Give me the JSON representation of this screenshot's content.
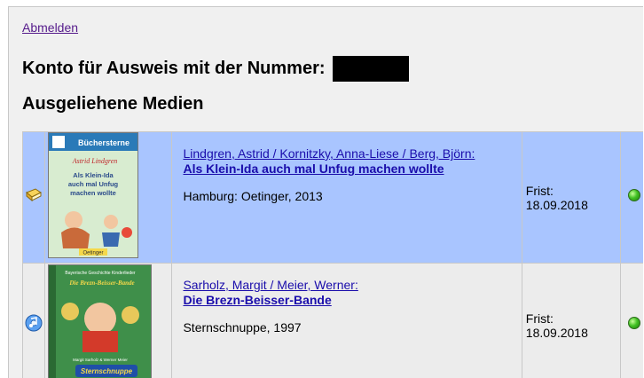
{
  "header": {
    "logout_label": "Abmelden",
    "account_heading": "Konto für Ausweis mit der Nummer:",
    "media_heading": "Ausgeliehene Medien"
  },
  "loans": [
    {
      "media_type_icon": "book-icon",
      "cover_title": "Als Klein-Ida auch mal Unfug machen wollte",
      "cover_series": "Büchersterne",
      "cover_author": "Astrid Lindgren",
      "cover_publisher": "Oetinger",
      "authors": "Lindgren, Astrid / Kornitzky, Anna-Liese / Berg, Björn:",
      "title": "Als Klein-Ida auch mal Unfug machen wollte",
      "publication": "Hamburg: Oetinger, 2013",
      "due_label": "Frist:",
      "due_date": "18.09.2018",
      "status_icon": "green-status-dot",
      "status_color": "#43c225"
    },
    {
      "media_type_icon": "audio-cd-icon",
      "cover_title": "Die Brezn-Beisser-Bande",
      "cover_author": "Margit Sarholz & Werner Meier",
      "cover_publisher": "Sternschnuppe",
      "authors": "Sarholz, Margit / Meier, Werner:",
      "title": "Die Brezn-Beisser-Bande",
      "publication": "Sternschnuppe, 1997",
      "due_label": "Frist:",
      "due_date": "18.09.2018",
      "status_icon": "green-status-dot",
      "status_color": "#43c225"
    }
  ],
  "colors": {
    "row_highlight": "#a9c5ff",
    "row_default": "#ececec",
    "link": "#1a0dab",
    "visited_link": "#551a8b"
  }
}
